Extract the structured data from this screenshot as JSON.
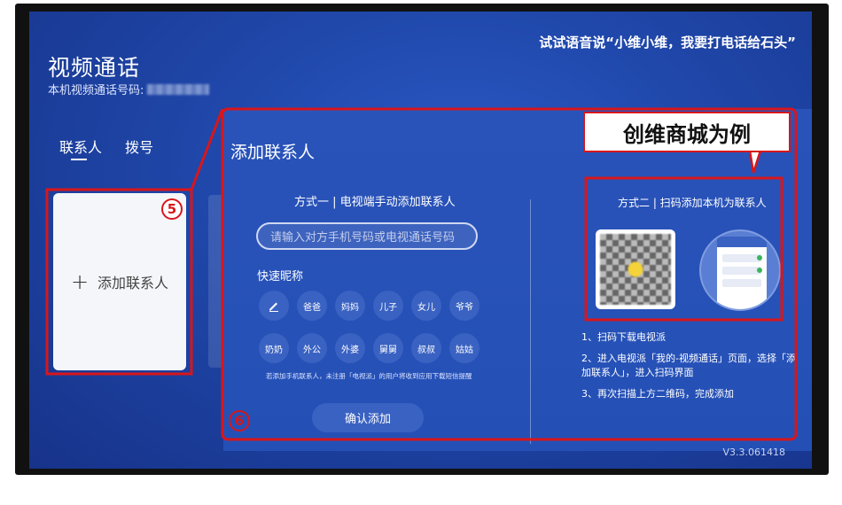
{
  "header": {
    "title": "视频通话",
    "number_label": "本机视频通话号码:",
    "voice_tip": "试试语音说“小维小维，我要打电话给石头”"
  },
  "tabs": [
    {
      "label": "联系人",
      "active": true
    },
    {
      "label": "拨号",
      "active": false
    }
  ],
  "add_contact_card": {
    "label": "添加联系人"
  },
  "panel": {
    "title": "添加联系人",
    "method1": {
      "title": "方式一 | 电视端手动添加联系人",
      "input_placeholder": "请输入对方手机号码或电视通话号码",
      "quick_label": "快速昵称",
      "nicknames": [
        "爸爸",
        "妈妈",
        "儿子",
        "女儿",
        "爷爷",
        "奶奶",
        "外公",
        "外婆",
        "舅舅",
        "叔叔",
        "姑姑"
      ],
      "note": "若添加手机联系人，未注册「电视派」的用户将收到应用下载短信提醒",
      "confirm_label": "确认添加"
    },
    "method2": {
      "title": "方式二 | 扫码添加本机为联系人",
      "steps": [
        "1、扫码下载电视派",
        "2、进入电视派「我的-视频通话」页面，选择「添加联系人」，进入扫码界面",
        "3、再次扫描上方二维码，完成添加"
      ]
    }
  },
  "version": "V3.3.061418",
  "annotations": {
    "banner": "创维商城为例",
    "badge5": "5",
    "badge6": "6",
    "color": "#d8161b"
  },
  "icons": {
    "edit": "pencil-icon",
    "add": "plus-icon"
  }
}
